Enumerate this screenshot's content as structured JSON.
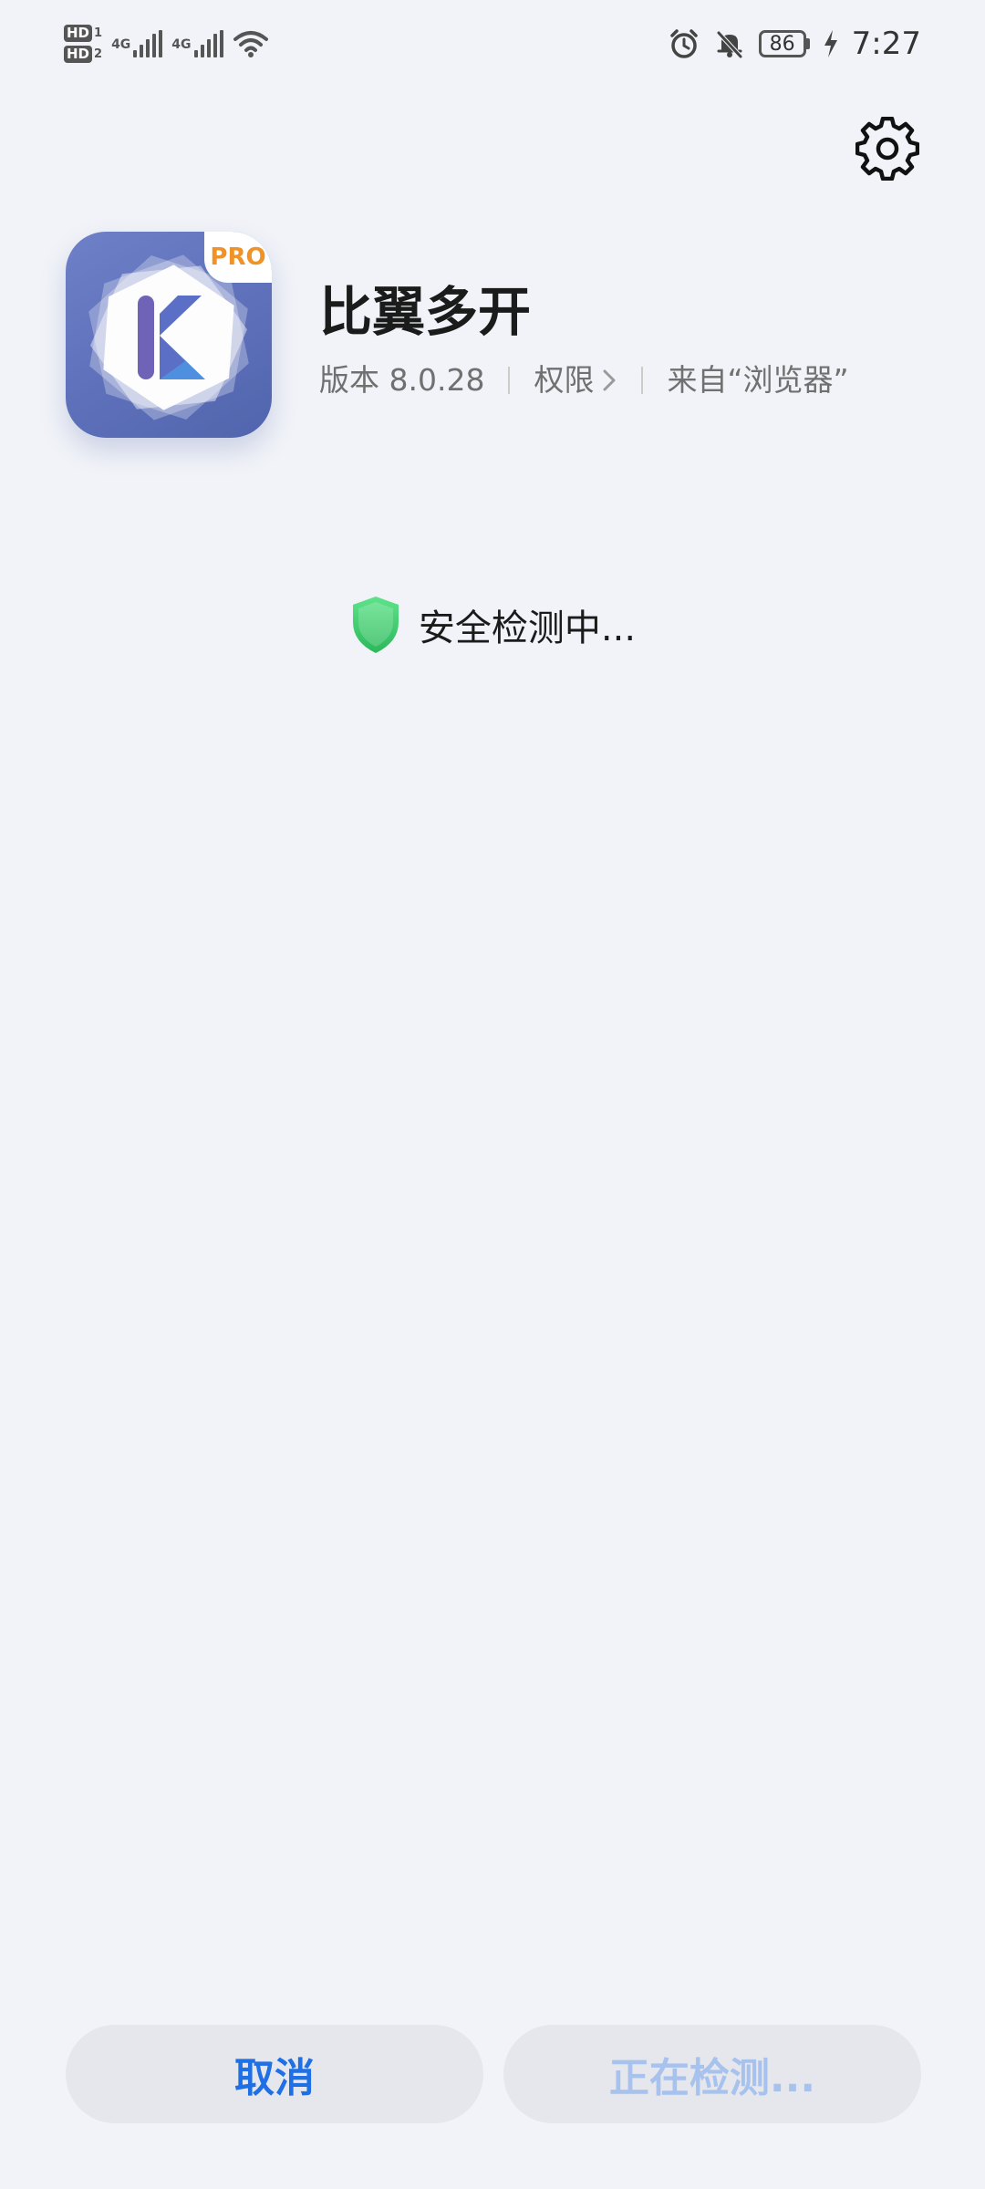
{
  "status_bar": {
    "sim1_label": "HD",
    "sim1_index": "1",
    "sim2_label": "HD",
    "sim2_index": "2",
    "net1": "4G",
    "net2": "4G",
    "battery": "86",
    "time": "7:27",
    "icons": [
      "signal-icon",
      "wifi-icon",
      "alarm-icon",
      "mute-icon",
      "battery-icon",
      "charging-icon"
    ]
  },
  "app": {
    "name": "比翼多开",
    "version": "版本 8.0.28",
    "permissions": "权限",
    "source": "来自“浏览器”",
    "icon_badge": "PRO",
    "colors": {
      "icon_bg": "#5e70ba",
      "badge": "#f09225"
    }
  },
  "security": {
    "status": "安全检测中...",
    "shield_color": "#3ccf6a"
  },
  "buttons": {
    "cancel": "取消",
    "detecting": "正在检测...",
    "cancel_color": "#1f6fe5",
    "detecting_color": "#a8c2ee"
  }
}
